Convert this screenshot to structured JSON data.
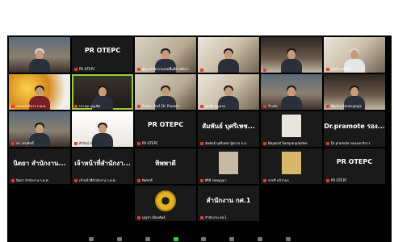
{
  "tiles": {
    "r0c0": "",
    "r0c1": {
      "big": "PR OTEPC",
      "cap": "PR OTEPC"
    },
    "r0c2": {
      "cap": "ผู้ดูแลสำนักงานเขตพื้นที่การศึกษา"
    },
    "r0c3": {
      "cap": ""
    },
    "r0c4": {
      "cap": ""
    },
    "r0c5": {
      "cap": "สุวิทย์ บุญมีศรี"
    },
    "r1c0": {
      "cap": "รองเลขาธิการ ก.ค.ศ."
    },
    "r1c1": {
      "cap": "ประชุม บุญเชิด"
    },
    "r1c2": {
      "cap": "Assoc. Prof. Dr. Prasert..."
    },
    "r1c3": {
      "cap": "ศุภชัย บุญนาค"
    },
    "r1c4": {
      "cap": "วีระชัย"
    },
    "r1c5": {
      "cap": "Narika Sorosupaya"
    },
    "r2c0": {
      "cap": "ดร. ทรงศักดิ์"
    },
    "r2c1": {
      "cap": "ศิริรัตน์ ตันชาญ"
    },
    "r2c2": {
      "big": "PR OTEPC",
      "cap": "PR OTEPC"
    },
    "r2c3": {
      "big": "สัมพันธ์ บุศรีเพช...",
      "cap": "สัมพันธ์ บุศรีเพชร ผู้ตรวจ ส.ป."
    },
    "r2c4": {
      "cap": "Naparat Sampanpakdee"
    },
    "r2c5": {
      "big": "Dr.pramote รอง...",
      "cap": "Dr.pramote รองเลขาธิการ"
    },
    "r3c0": {
      "big": "นิตยา สำนักงาน...",
      "cap": "นิตยา สำนักงาน ก.ค.ศ."
    },
    "r3c1": {
      "big": "เจ้าหน้าที่สำนักงา...",
      "cap": "เจ้าหน้าที่สำนักงาน ก.ค.ศ."
    },
    "r3c2": {
      "big": "ทิพพาดี",
      "cap": "ทิพพาดี"
    },
    "r3c3": {
      "cap": "ศิริมี รอดบุญมา"
    },
    "r3c4": {
      "cap": "ชาตรี แก้วกนก"
    },
    "r3c5": {
      "big": "PR OTEPC",
      "cap": "PR OTEPC"
    },
    "r4c2": {
      "cap": "บุญชา เจียมพันธ์"
    },
    "r4c3": {
      "big": "สำนักงาน กศ.1",
      "cap": "สำนักงาน กศ.1"
    }
  },
  "colors": {
    "active_border": "#9acd32",
    "muted_mic": "#e53935"
  }
}
